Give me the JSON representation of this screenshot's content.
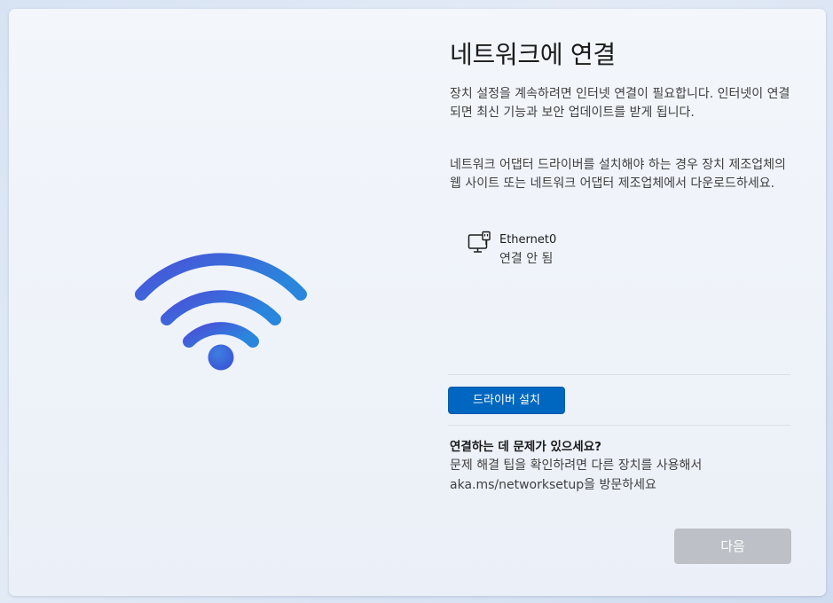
{
  "page": {
    "title": "네트워크에 연결",
    "paragraph1": "장치 설정을 계속하려면 인터넷 연결이 필요합니다. 인터넷이 연결되면 최신 기능과 보안 업데이트를 받게 됩니다.",
    "paragraph2": "네트워크 어댑터 드라이버를 설치해야 하는 경우 장치 제조업체의 웹 사이트 또는 네트워크 어댑터 제조업체에서 다운로드하세요."
  },
  "adapter": {
    "name": "Ethernet0",
    "status": "연결 안 됨",
    "icon": "ethernet-network-icon"
  },
  "buttons": {
    "install_driver": "드라이버 설치",
    "next": "다음"
  },
  "help": {
    "title": "연결하는 데 문제가 있으세요?",
    "line1": "문제 해결 팁을 확인하려면 다른 장치를 사용해서",
    "line2": "aka.ms/networksetup을 방문하세요"
  },
  "colors": {
    "accent": "#0067c0",
    "next_disabled": "#bdc1c7",
    "wifi_gradient_start": "#4b4fd8",
    "wifi_gradient_end": "#2a86dc"
  }
}
